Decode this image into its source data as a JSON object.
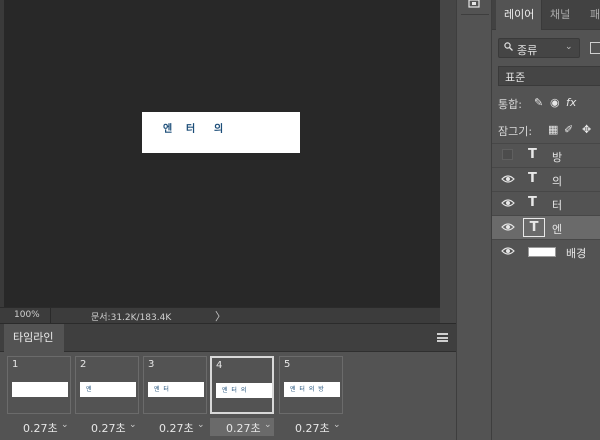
{
  "document": {
    "canvas_chars": [
      "엔",
      "터",
      "의"
    ],
    "zoom": "100%",
    "doc_size": "문서:31.2K/183.4K",
    "status_arrow": "〉"
  },
  "layers_panel": {
    "tabs": [
      "레이어",
      "채널",
      "패"
    ],
    "filter": {
      "value": "종류",
      "icon": "search-icon"
    },
    "blend_mode": "표준",
    "unify_label": "통합:",
    "lock_label": "잠그기:",
    "layers": [
      {
        "name": "방",
        "type": "text",
        "visible": false,
        "selected": false
      },
      {
        "name": "의",
        "type": "text",
        "visible": true,
        "selected": false
      },
      {
        "name": "터",
        "type": "text",
        "visible": true,
        "selected": false
      },
      {
        "name": "엔",
        "type": "text",
        "visible": true,
        "selected": true
      },
      {
        "name": "배경",
        "type": "background",
        "visible": true,
        "selected": false
      }
    ]
  },
  "timeline": {
    "tab_label": "타임라인",
    "frames": [
      {
        "num": "1",
        "delay": "0.27초",
        "thumb_text": "",
        "selected": false
      },
      {
        "num": "2",
        "delay": "0.27초",
        "thumb_text": "엔",
        "selected": false
      },
      {
        "num": "3",
        "delay": "0.27초",
        "thumb_text": "엔 터",
        "selected": false
      },
      {
        "num": "4",
        "delay": "0.27초",
        "thumb_text": "엔 터 의",
        "selected": true
      },
      {
        "num": "5",
        "delay": "0.27초",
        "thumb_text": "엔 터 의 방",
        "selected": false
      }
    ]
  },
  "colors": {
    "canvas_bg": "#282828",
    "panel_bg": "#535353",
    "text_accent": "#1d4e79",
    "selected_row": "#6a6a6a"
  }
}
